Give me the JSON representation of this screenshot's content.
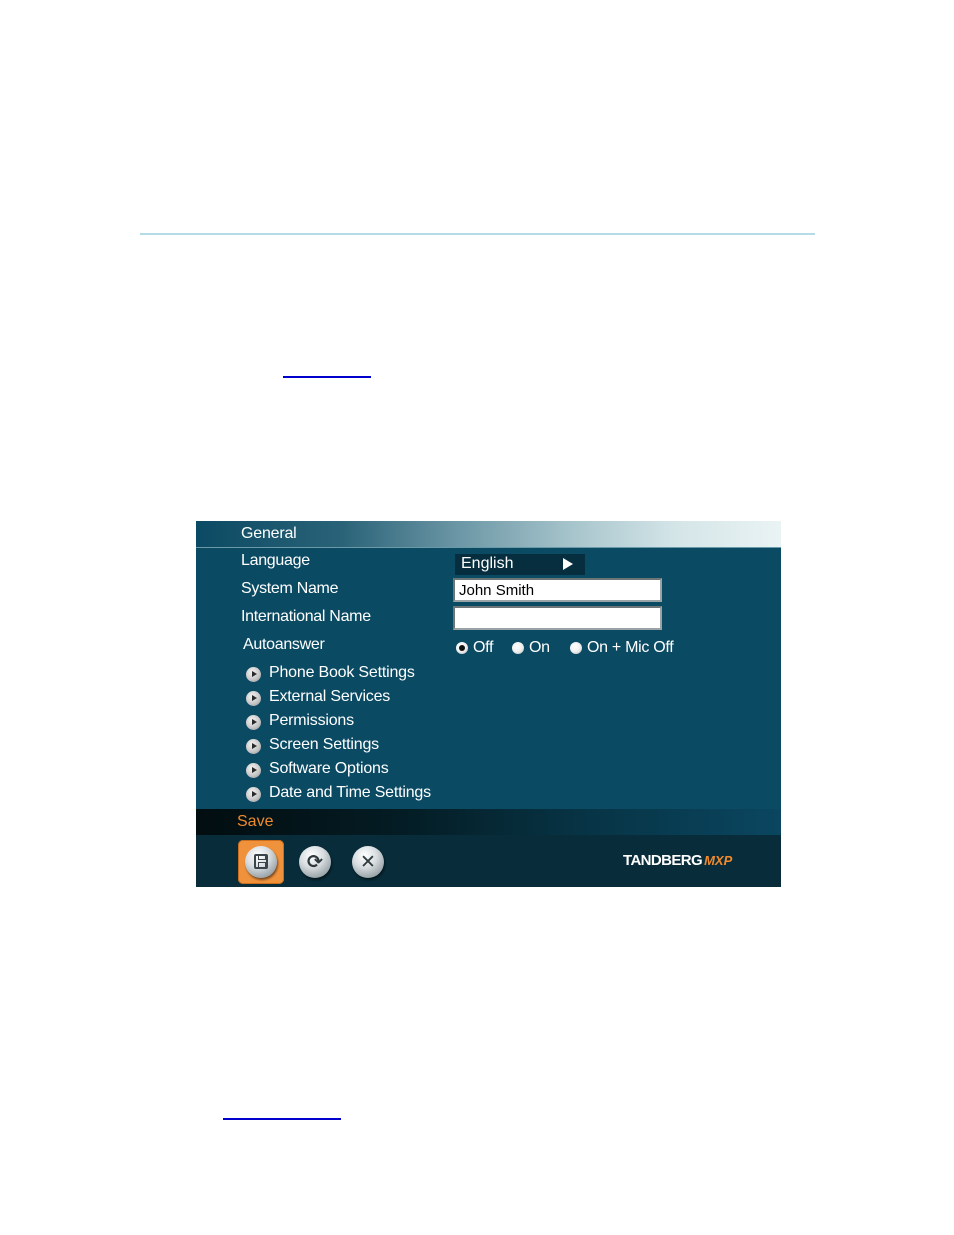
{
  "page": {
    "links": [
      {
        "label": ""
      },
      {
        "label": ""
      }
    ]
  },
  "panel": {
    "title": "General",
    "fields": {
      "language": {
        "label": "Language",
        "value": "English"
      },
      "system_name": {
        "label": "System Name",
        "value": "John Smith"
      },
      "international_name": {
        "label": "International Name",
        "value": ""
      },
      "autoanswer": {
        "label": "Autoanswer",
        "options": [
          {
            "label": "Off",
            "selected": true
          },
          {
            "label": "On",
            "selected": false
          },
          {
            "label": "On + Mic Off",
            "selected": false
          }
        ]
      }
    },
    "menu_items": [
      {
        "label": "Phone Book Settings",
        "icon": "play-circle-icon"
      },
      {
        "label": "External Services",
        "icon": "play-circle-icon"
      },
      {
        "label": "Permissions",
        "icon": "play-circle-icon"
      },
      {
        "label": "Screen Settings",
        "icon": "play-circle-icon"
      },
      {
        "label": "Software Options",
        "icon": "play-circle-icon"
      },
      {
        "label": "Date and Time Settings",
        "icon": "play-circle-icon"
      }
    ],
    "status_text": "Save",
    "toolbar": {
      "buttons": [
        {
          "name": "save",
          "icon": "floppy-disk-icon",
          "active": true
        },
        {
          "name": "refresh",
          "icon": "refresh-icon",
          "glyph": "⟳",
          "active": false
        },
        {
          "name": "cancel",
          "icon": "close-icon",
          "glyph": "✕",
          "active": false
        }
      ]
    },
    "brand": {
      "main": "TANDBERG",
      "sub": "MXP"
    },
    "colors": {
      "panel_bg": "#0b4a63",
      "accent": "#f08a2c",
      "toolbar_bg": "#082c3a",
      "rule": "#b5dce6",
      "link": "#0000cc"
    }
  }
}
